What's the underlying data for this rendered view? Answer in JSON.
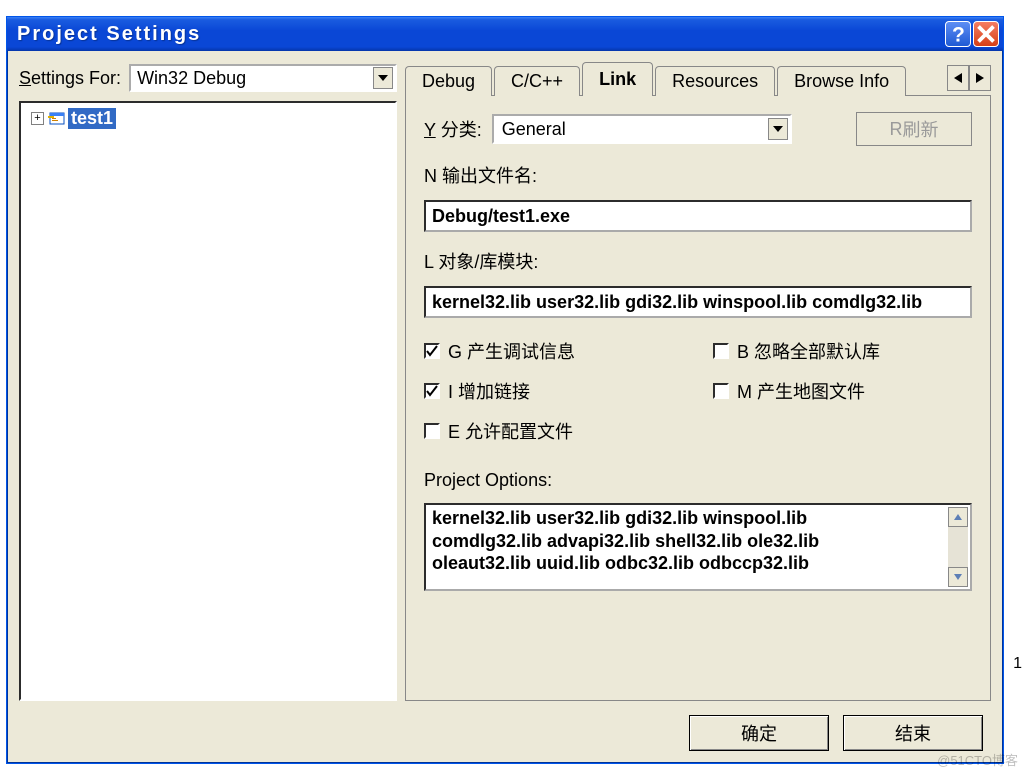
{
  "window": {
    "title": "Project Settings"
  },
  "settings_for": {
    "label_pre": "S",
    "label_rest": "ettings For:",
    "value": "Win32 Debug"
  },
  "tree": {
    "item": "test1"
  },
  "tabs": {
    "t0": "Debug",
    "t1": "C/C++",
    "t2": "Link",
    "t3": "Resources",
    "t4": "Browse Info"
  },
  "category": {
    "label_u": "Y",
    "label_rest": " 分类:",
    "value": "General"
  },
  "refresh": {
    "label_u": "R",
    "label_rest": " 刷新"
  },
  "output_file": {
    "label_u": "N",
    "label_rest": " 输出文件名:",
    "value": "Debug/test1.exe"
  },
  "object_modules": {
    "label_u": "L",
    "label_rest": " 对象/库模块:",
    "value": "kernel32.lib user32.lib gdi32.lib winspool.lib comdlg32.lib"
  },
  "checks": {
    "gen_debug": {
      "u": "G",
      "rest": " 产生调试信息",
      "checked": true
    },
    "ignore_default": {
      "u": "B",
      "rest": " 忽略全部默认库",
      "checked": false
    },
    "incremental": {
      "u": "I",
      "rest": " 增加链接",
      "checked": true
    },
    "mapfile": {
      "u": "M",
      "rest": " 产生地图文件",
      "checked": false
    },
    "profile": {
      "u": "E",
      "rest": " 允许配置文件",
      "checked": false
    }
  },
  "project_options": {
    "label_pre": "Project ",
    "label_u": "O",
    "label_post": "ptions:",
    "value": "kernel32.lib user32.lib gdi32.lib winspool.lib\ncomdlg32.lib advapi32.lib shell32.lib ole32.lib\noleaut32.lib uuid.lib odbc32.lib odbccp32.lib"
  },
  "buttons": {
    "ok": "确定",
    "close": "结束"
  },
  "side_number": "1",
  "watermark": "@51CTO博客"
}
